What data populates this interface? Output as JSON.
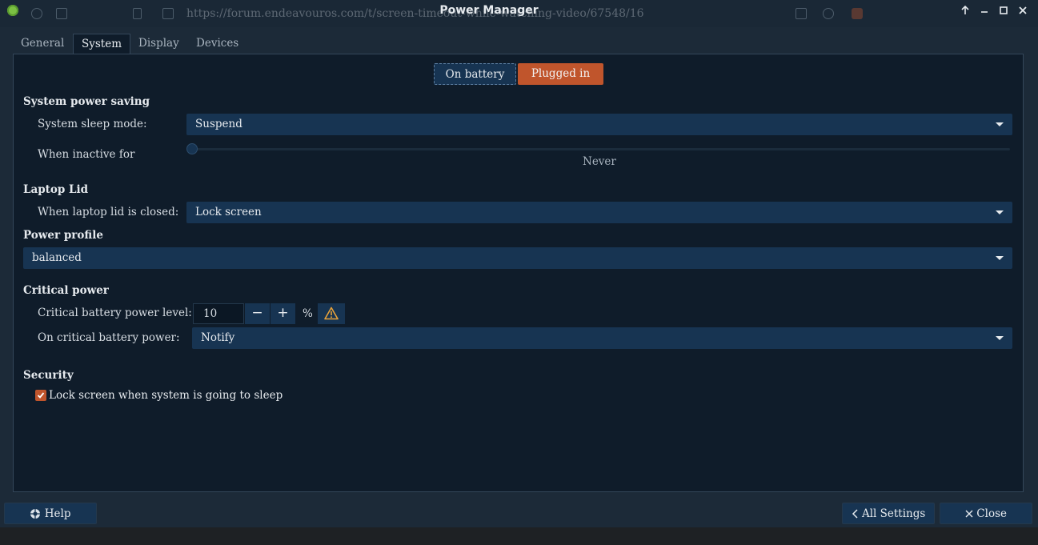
{
  "window": {
    "title": "Power Manager",
    "background_url": "https://forum.endeavouros.com/t/screen-timeout-while-watching-video/67548/16"
  },
  "tabs": [
    "General",
    "System",
    "Display",
    "Devices"
  ],
  "active_tab": "System",
  "power_source": {
    "on_battery": "On battery",
    "plugged_in": "Plugged in",
    "selected": "Plugged in"
  },
  "system_power_saving": {
    "heading": "System power saving",
    "sleep_mode_label": "System sleep mode:",
    "sleep_mode_value": "Suspend",
    "inactive_label": "When inactive for",
    "inactive_value": "Never",
    "inactive_slider_fraction": 0
  },
  "laptop_lid": {
    "heading": "Laptop Lid",
    "closed_label": "When laptop lid is closed:",
    "closed_value": "Lock screen"
  },
  "power_profile": {
    "heading": "Power profile",
    "value": "balanced"
  },
  "critical_power": {
    "heading": "Critical power",
    "level_label": "Critical battery power level:",
    "level_value": "10",
    "minus": "−",
    "plus": "+",
    "unit": "%",
    "action_label": "On critical battery power:",
    "action_value": "Notify"
  },
  "security": {
    "heading": "Security",
    "lock_label": "Lock screen when system is going to sleep",
    "lock_checked": true
  },
  "footer": {
    "help": "Help",
    "all_settings": "All Settings",
    "close": "Close"
  },
  "colors": {
    "accent": "#c0552c",
    "button": "#173452",
    "panel": "#0f1c2a",
    "warning": "#e8a23a"
  }
}
